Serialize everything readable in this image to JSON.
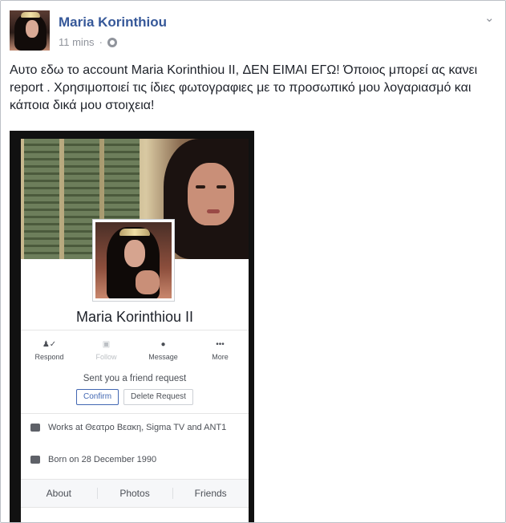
{
  "post": {
    "author": "Maria Korinthiou",
    "time": "11 mins",
    "privacy_icon": "globe-icon",
    "menu_icon": "chevron-down-icon",
    "text": "Αυτο εδω το account Maria Korinthiou II, ΔΕΝ ΕΙΜΑΙ ΕΓΩ! Όποιος μπορεί ας κανει report . Χρησιμοποιεί τις ίδιες φωτογραφιες με το προσωπικό μου λογαριασμό και κάποια δικά μου στοιχεια!"
  },
  "screenshot": {
    "profile_name": "Maria Korinthiou II",
    "actions": [
      {
        "label": "Respond",
        "icon": "person-check-icon"
      },
      {
        "label": "Follow",
        "icon": "follow-icon"
      },
      {
        "label": "Message",
        "icon": "messenger-icon"
      },
      {
        "label": "More",
        "icon": "more-dots-icon"
      }
    ],
    "request_text": "Sent you a friend request",
    "confirm_label": "Confirm",
    "delete_label": "Delete Request",
    "work": "Works at Θεατρο Βεακη, Sigma TV and ANT1",
    "born": "Born on 28 December 1990",
    "tabs": [
      "About",
      "Photos",
      "Friends"
    ]
  }
}
